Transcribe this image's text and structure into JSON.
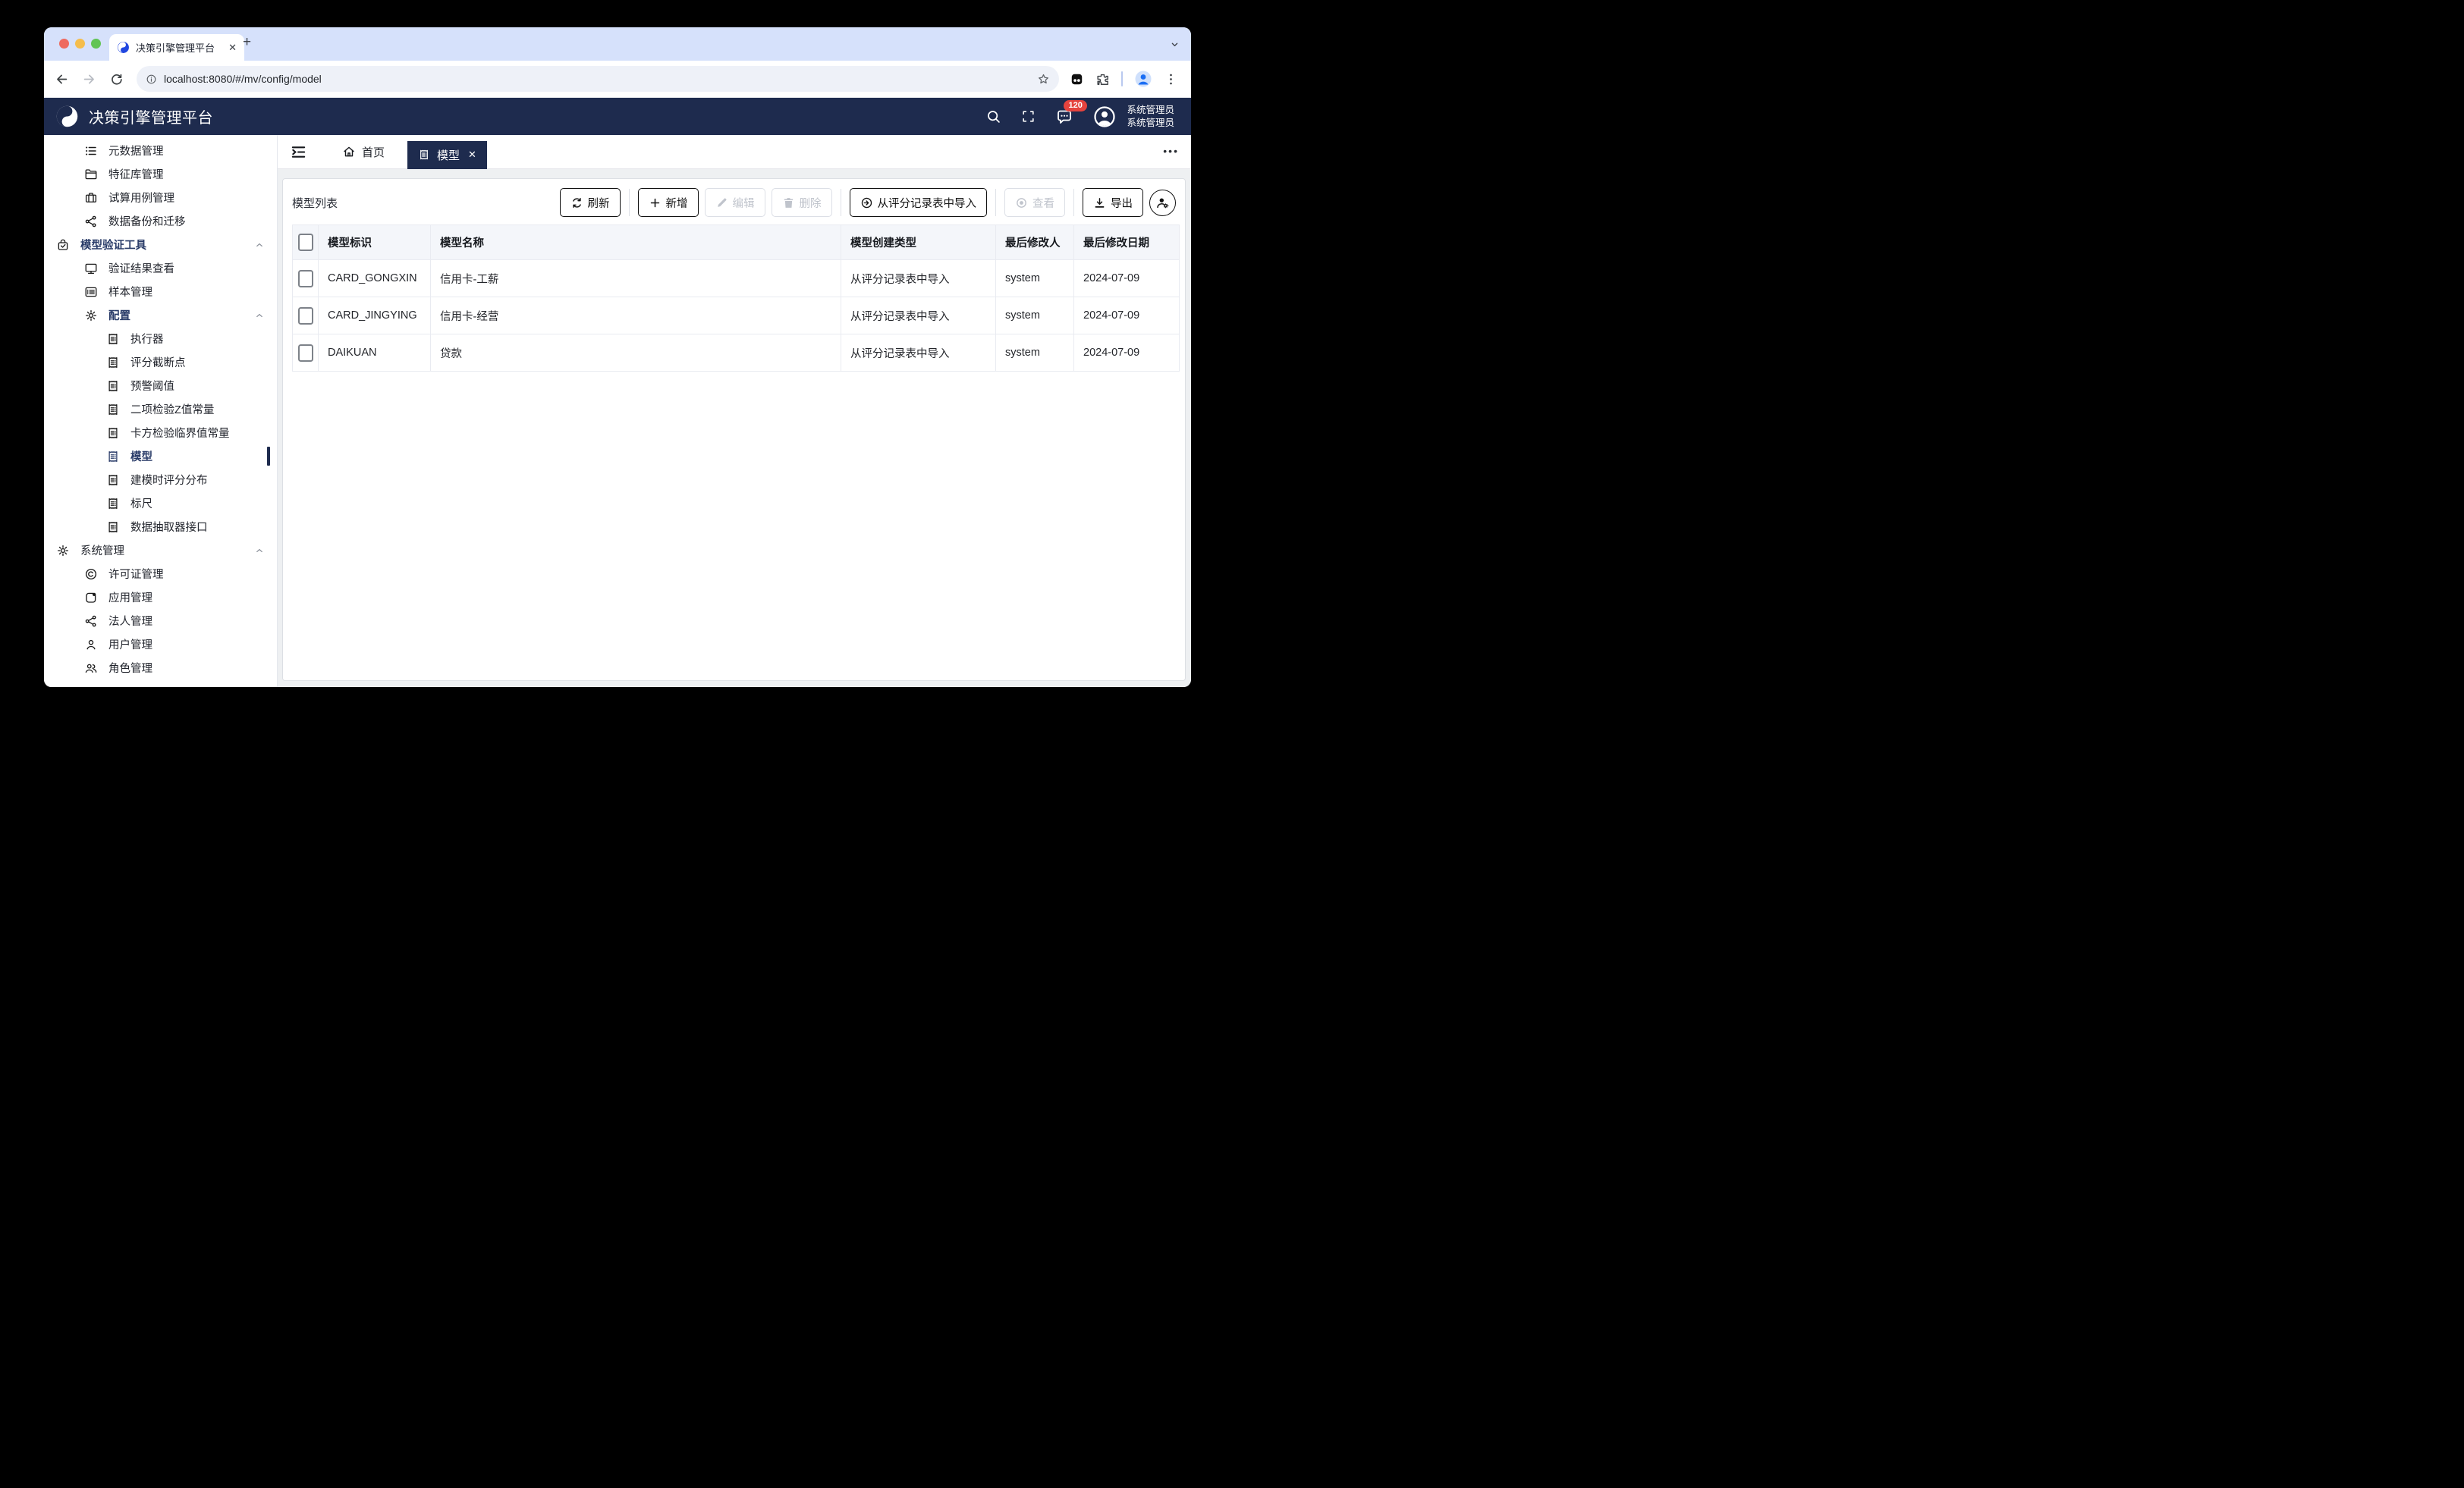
{
  "browser": {
    "tab_title": "决策引擎管理平台",
    "url": "localhost:8080/#/mv/config/model"
  },
  "navbar": {
    "title": "决策引擎管理平台",
    "badge_count": "120",
    "user_name": "系统管理员",
    "user_role": "系统管理员"
  },
  "sidebar": {
    "items": [
      {
        "label": "元数据管理",
        "dn": "sidebar-item-metadata-management",
        "cls": "side-item lvl1",
        "icon": "#ic-olist",
        "icon_name": "ordered-list-icon"
      },
      {
        "label": "特征库管理",
        "dn": "sidebar-item-feature-library",
        "cls": "side-item lvl1",
        "icon": "#ic-folder",
        "icon_name": "folder-icon"
      },
      {
        "label": "试算用例管理",
        "dn": "sidebar-item-trial-case",
        "cls": "side-item lvl1",
        "icon": "#ic-case",
        "icon_name": "briefcase-icon"
      },
      {
        "label": "数据备份和迁移",
        "dn": "sidebar-item-data-backup-migration",
        "cls": "side-item lvl1",
        "icon": "#ic-share",
        "icon_name": "share-icon"
      },
      {
        "label": "模型验证工具",
        "dn": "sidebar-item-model-validation-tools",
        "cls": "side-item lvl0 sect has-chev",
        "icon": "#ic-bagcheck",
        "icon_name": "security-check-icon"
      },
      {
        "label": "验证结果查看",
        "dn": "sidebar-item-validation-results",
        "cls": "side-item lvl1",
        "icon": "#ic-monitor",
        "icon_name": "monitor-icon"
      },
      {
        "label": "样本管理",
        "dn": "sidebar-item-sample-management",
        "cls": "side-item lvl1",
        "icon": "#ic-listcard",
        "icon_name": "list-card-icon"
      },
      {
        "label": "配置",
        "dn": "sidebar-item-config",
        "cls": "side-item lvl1 sect has-chev",
        "icon": "#ic-gear",
        "icon_name": "gear-icon"
      },
      {
        "label": "执行器",
        "dn": "sidebar-item-executor",
        "cls": "side-item lvl2",
        "icon": "#ic-receipt",
        "icon_name": "receipt-icon"
      },
      {
        "label": "评分截断点",
        "dn": "sidebar-item-score-cutoff",
        "cls": "side-item lvl2",
        "icon": "#ic-receipt",
        "icon_name": "receipt-icon"
      },
      {
        "label": "预警阈值",
        "dn": "sidebar-item-warning-threshold",
        "cls": "side-item lvl2",
        "icon": "#ic-receipt",
        "icon_name": "receipt-icon"
      },
      {
        "label": "二项检验Z值常量",
        "dn": "sidebar-item-binomial-z-constant",
        "cls": "side-item lvl2",
        "icon": "#ic-receipt",
        "icon_name": "receipt-icon"
      },
      {
        "label": "卡方检验临界值常量",
        "dn": "sidebar-item-chi-square-critical",
        "cls": "side-item lvl2",
        "icon": "#ic-receipt",
        "icon_name": "receipt-icon"
      },
      {
        "label": "模型",
        "dn": "sidebar-item-model",
        "cls": "side-item lvl2 active",
        "icon": "#ic-receipt",
        "icon_name": "receipt-icon"
      },
      {
        "label": "建模时评分分布",
        "dn": "sidebar-item-modeling-score-distribution",
        "cls": "side-item lvl2",
        "icon": "#ic-receipt",
        "icon_name": "receipt-icon"
      },
      {
        "label": "标尺",
        "dn": "sidebar-item-ruler",
        "cls": "side-item lvl2",
        "icon": "#ic-receipt",
        "icon_name": "receipt-icon"
      },
      {
        "label": "数据抽取器接口",
        "dn": "sidebar-item-data-extractor-api",
        "cls": "side-item lvl2",
        "icon": "#ic-receipt",
        "icon_name": "receipt-icon"
      },
      {
        "label": "系统管理",
        "dn": "sidebar-item-system-management",
        "cls": "side-item lvl0 has-chev",
        "icon": "#ic-gear",
        "icon_name": "gear-icon"
      },
      {
        "label": "许可证管理",
        "dn": "sidebar-item-license-management",
        "cls": "side-item lvl1",
        "icon": "#ic-copyright",
        "icon_name": "copyright-icon"
      },
      {
        "label": "应用管理",
        "dn": "sidebar-item-app-management",
        "cls": "side-item lvl1",
        "icon": "#ic-app",
        "icon_name": "app-icon"
      },
      {
        "label": "法人管理",
        "dn": "sidebar-item-legal-entity-management",
        "cls": "side-item lvl1",
        "icon": "#ic-share",
        "icon_name": "share-icon"
      },
      {
        "label": "用户管理",
        "dn": "sidebar-item-user-management",
        "cls": "side-item lvl1",
        "icon": "#ic-user",
        "icon_name": "user-icon"
      },
      {
        "label": "角色管理",
        "dn": "sidebar-item-role-management",
        "cls": "side-item lvl1",
        "icon": "#ic-users",
        "icon_name": "users-icon"
      }
    ]
  },
  "tabs": {
    "home": "首页",
    "active": "模型"
  },
  "toolbar": {
    "title": "模型列表",
    "refresh": "刷新",
    "add": "新增",
    "edit": "编辑",
    "delete": "删除",
    "import": "从评分记录表中导入",
    "view": "查看",
    "export": "导出"
  },
  "table": {
    "columns": [
      "模型标识",
      "模型名称",
      "模型创建类型",
      "最后修改人",
      "最后修改日期"
    ],
    "rows": [
      {
        "id": "CARD_GONGXIN",
        "name": "信用卡-工薪",
        "type": "从评分记录表中导入",
        "editor": "system",
        "date": "2024-07-09"
      },
      {
        "id": "CARD_JINGYING",
        "name": "信用卡-经营",
        "type": "从评分记录表中导入",
        "editor": "system",
        "date": "2024-07-09"
      },
      {
        "id": "DAIKUAN",
        "name": "贷款",
        "type": "从评分记录表中导入",
        "editor": "system",
        "date": "2024-07-09"
      }
    ]
  },
  "colors": {
    "navy": "#1e2b4e",
    "badge_red": "#e5433e",
    "tabstrip_blue": "#d6e1fb",
    "page_bg": "#eef0f2",
    "favicon_blue": "#2046e0"
  },
  "icons": {
    "ordered-list-icon": "list with bullets",
    "folder-icon": "folder",
    "briefcase-icon": "suitcase",
    "share-icon": "share nodes",
    "security-check-icon": "bag with checkmark",
    "monitor-icon": "display",
    "list-card-icon": "card with lines",
    "gear-icon": "cog",
    "receipt-icon": "zigzag document",
    "copyright-icon": "circled C",
    "app-icon": "square with dot",
    "user-icon": "person",
    "users-icon": "two persons",
    "search-icon": "magnifier",
    "fullscreen-icon": "corner brackets",
    "message-icon": "chat bubble with dots",
    "refresh-icon": "circular arrows",
    "plus-icon": "plus",
    "edit-icon": "pencil",
    "delete-icon": "trash",
    "import-icon": "arrow in circle",
    "view-icon": "ringed dot",
    "export-icon": "download arrow",
    "user-settings-icon": "person with cog",
    "collapse-icon": "lines with arrow",
    "home-icon": "house"
  }
}
